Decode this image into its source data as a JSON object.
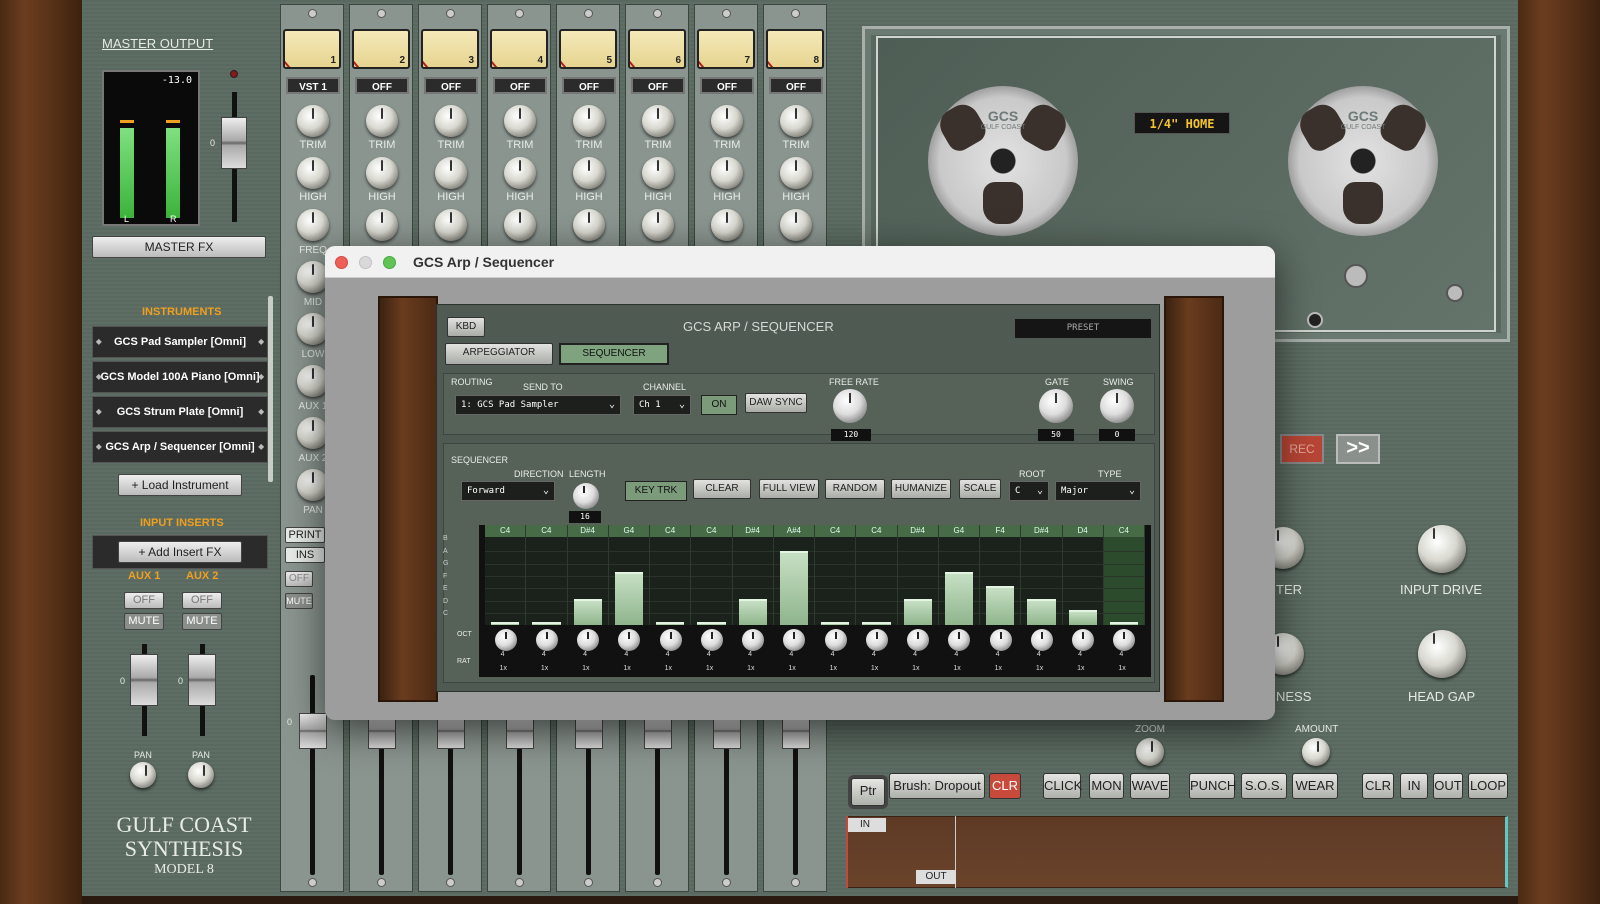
{
  "master": {
    "title": "MASTER OUTPUT",
    "readout": "-13.0",
    "meter_l": "L",
    "meter_r": "R",
    "fader_zero": "0",
    "fx_button": "MASTER FX"
  },
  "instruments": {
    "header": "INSTRUMENTS",
    "items": [
      "GCS Pad Sampler [Omni]",
      "GCS Model 100A Piano [Omni]",
      "GCS Strum Plate [Omni]",
      "GCS Arp / Sequencer [Omni]"
    ],
    "load_button": "+ Load Instrument"
  },
  "inserts": {
    "header": "INPUT INSERTS",
    "add_button": "+ Add Insert FX"
  },
  "aux": [
    {
      "label": "AUX 1",
      "off": "OFF",
      "mute": "MUTE",
      "zero": "0",
      "pan": "PAN"
    },
    {
      "label": "AUX 2",
      "off": "OFF",
      "mute": "MUTE",
      "zero": "0",
      "pan": "PAN"
    }
  ],
  "brand": {
    "line1": "GULF COAST",
    "line2": "SYNTHESIS",
    "line3": "MODEL 8"
  },
  "channels": [
    {
      "num": "1",
      "label": "VST 1"
    },
    {
      "num": "2",
      "label": "OFF"
    },
    {
      "num": "3",
      "label": "OFF"
    },
    {
      "num": "4",
      "label": "OFF"
    },
    {
      "num": "5",
      "label": "OFF"
    },
    {
      "num": "6",
      "label": "OFF"
    },
    {
      "num": "7",
      "label": "OFF"
    },
    {
      "num": "8",
      "label": "OFF"
    }
  ],
  "strip_labels": {
    "trim": "TRIM",
    "high": "HIGH",
    "freq": "FREQ",
    "mid": "MID",
    "low": "LOW",
    "aux1": "AUX 1",
    "aux2": "AUX 2",
    "pan": "PAN",
    "print": "PRINT",
    "ins": "INS",
    "off": "OFF",
    "mute": "MUTE",
    "fader_zero": "0"
  },
  "tape": {
    "display": "1/4\" HOME",
    "rec": "REC",
    "ff": ">>",
    "knobs": {
      "ter": "TER",
      "ness": "NESS",
      "input_drive": "INPUT DRIVE",
      "head_gap": "HEAD GAP",
      "zoom": "ZOOM",
      "amount": "AMOUNT"
    }
  },
  "toolbar": {
    "ptr": "Ptr",
    "brush": "Brush: Dropout",
    "clr": "CLR",
    "click": "CLICK",
    "mon": "MON",
    "wave": "WAVE",
    "punch": "PUNCH",
    "sos": "S.O.S.",
    "wear": "WEAR",
    "clr2": "CLR",
    "in": "IN",
    "out": "OUT",
    "loop": "LOOP"
  },
  "timeline": {
    "in": "IN",
    "out": "OUT"
  },
  "reel_brand": {
    "name": "GCS",
    "sub": "GULF COAST"
  },
  "window": {
    "title": "GCS Arp / Sequencer"
  },
  "seq": {
    "kbd": "KBD",
    "title": "GCS ARP / SEQUENCER",
    "preset": "PRESET",
    "tab_arp": "ARPEGGIATOR",
    "tab_seq": "SEQUENCER",
    "routing": "ROUTING",
    "send_to_label": "SEND TO",
    "send_to": "1: GCS Pad Sampler",
    "channel_label": "CHANNEL",
    "channel": "Ch 1",
    "on": "ON",
    "daw_sync": "DAW SYNC",
    "free_rate_label": "FREE RATE",
    "free_rate": "120",
    "gate_label": "GATE",
    "gate": "50",
    "swing_label": "SWING",
    "swing": "0",
    "sequencer_label": "SEQUENCER",
    "direction_label": "DIRECTION",
    "direction": "Forward",
    "length_label": "LENGTH",
    "length": "16",
    "key_trk": "KEY TRK",
    "clear": "CLEAR",
    "full_view": "FULL VIEW",
    "random": "RANDOM",
    "humanize": "HUMANIZE",
    "scale": "SCALE",
    "root_label": "ROOT",
    "root": "C",
    "type_label": "TYPE",
    "type": "Major",
    "row_labels": [
      "B",
      "A",
      "G",
      "F",
      "E",
      "D",
      "C"
    ],
    "oct_label": "OCT",
    "rat_label": "RAT",
    "steps": [
      {
        "note": "C4",
        "level": 0.04,
        "oct": "4",
        "rate": "1x"
      },
      {
        "note": "C4",
        "level": 0.04,
        "oct": "4",
        "rate": "1x"
      },
      {
        "note": "D#4",
        "level": 0.3,
        "oct": "4",
        "rate": "1x"
      },
      {
        "note": "G4",
        "level": 0.62,
        "oct": "4",
        "rate": "1x"
      },
      {
        "note": "C4",
        "level": 0.04,
        "oct": "4",
        "rate": "1x"
      },
      {
        "note": "C4",
        "level": 0.04,
        "oct": "4",
        "rate": "1x"
      },
      {
        "note": "D#4",
        "level": 0.3,
        "oct": "4",
        "rate": "1x"
      },
      {
        "note": "A#4",
        "level": 0.86,
        "oct": "4",
        "rate": "1x"
      },
      {
        "note": "C4",
        "level": 0.04,
        "oct": "4",
        "rate": "1x"
      },
      {
        "note": "C4",
        "level": 0.04,
        "oct": "4",
        "rate": "1x"
      },
      {
        "note": "D#4",
        "level": 0.3,
        "oct": "4",
        "rate": "1x"
      },
      {
        "note": "G4",
        "level": 0.62,
        "oct": "4",
        "rate": "1x"
      },
      {
        "note": "F4",
        "level": 0.45,
        "oct": "4",
        "rate": "1x"
      },
      {
        "note": "D#4",
        "level": 0.3,
        "oct": "4",
        "rate": "1x"
      },
      {
        "note": "D4",
        "level": 0.18,
        "oct": "4",
        "rate": "1x"
      },
      {
        "note": "C4",
        "level": 0.04,
        "oct": "4",
        "rate": "1x"
      }
    ]
  },
  "colors": {
    "accent_orange": "#f0a020",
    "seq_green": "#9cc49a",
    "rec_red": "#c84a3a"
  }
}
